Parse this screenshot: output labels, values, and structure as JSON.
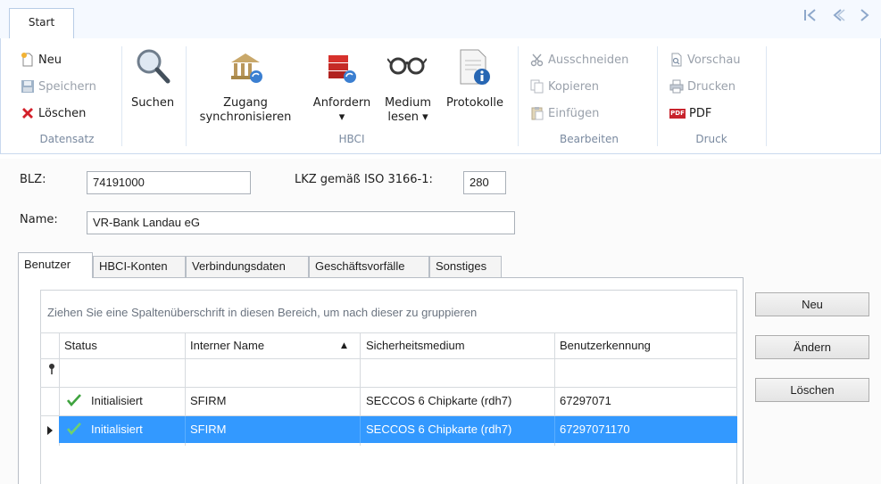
{
  "ribbon": {
    "tab_start": "Start",
    "groups": {
      "datensatz": {
        "label": "Datensatz",
        "neu": "Neu",
        "speichern": "Speichern",
        "loeschen": "Löschen"
      },
      "suchen": {
        "label": "Suchen"
      },
      "hbci": {
        "label": "HBCI",
        "zugang_line1": "Zugang",
        "zugang_line2": "synchronisieren",
        "anfordern": "Anfordern",
        "medium_line1": "Medium",
        "medium_line2": "lesen",
        "protokolle": "Protokolle"
      },
      "bearbeiten": {
        "label": "Bearbeiten",
        "ausschneiden": "Ausschneiden",
        "kopieren": "Kopieren",
        "einfuegen": "Einfügen"
      },
      "druck": {
        "label": "Druck",
        "vorschau": "Vorschau",
        "drucken": "Drucken",
        "pdf": "PDF",
        "pdf_badge": "PDF"
      }
    },
    "nav": {
      "first": "|<",
      "prev": "<",
      "next": ">"
    }
  },
  "form": {
    "blz_label": "BLZ:",
    "blz_value": "74191000",
    "lkz_label": "LKZ gemäß ISO 3166-1:",
    "lkz_value": "280",
    "name_label": "Name:",
    "name_value": "VR-Bank Landau eG"
  },
  "tabs": [
    "Benutzer",
    "HBCI-Konten",
    "Verbindungsdaten",
    "Geschäftsvorfälle",
    "Sonstiges"
  ],
  "grid": {
    "group_hint": "Ziehen Sie eine Spaltenüberschrift in diesen Bereich, um nach dieser zu gruppieren",
    "columns": [
      "Status",
      "Interner Name",
      "Sicherheitsmedium",
      "Benutzerkennung"
    ],
    "rows": [
      {
        "status": "Initialisiert",
        "name": "SFIRM",
        "medium": "SECCOS 6 Chipkarte (rdh7)",
        "kennung": "67297071"
      },
      {
        "status": "Initialisiert",
        "name": "SFIRM",
        "medium": "SECCOS 6 Chipkarte (rdh7)",
        "kennung": "67297071170"
      }
    ]
  },
  "actions": {
    "neu": "Neu",
    "aendern": "Ändern",
    "loeschen": "Löschen"
  },
  "colors": {
    "selection": "#3399ff",
    "ribbon_border": "#c9d9ee",
    "check_green": "#3fa33f"
  }
}
